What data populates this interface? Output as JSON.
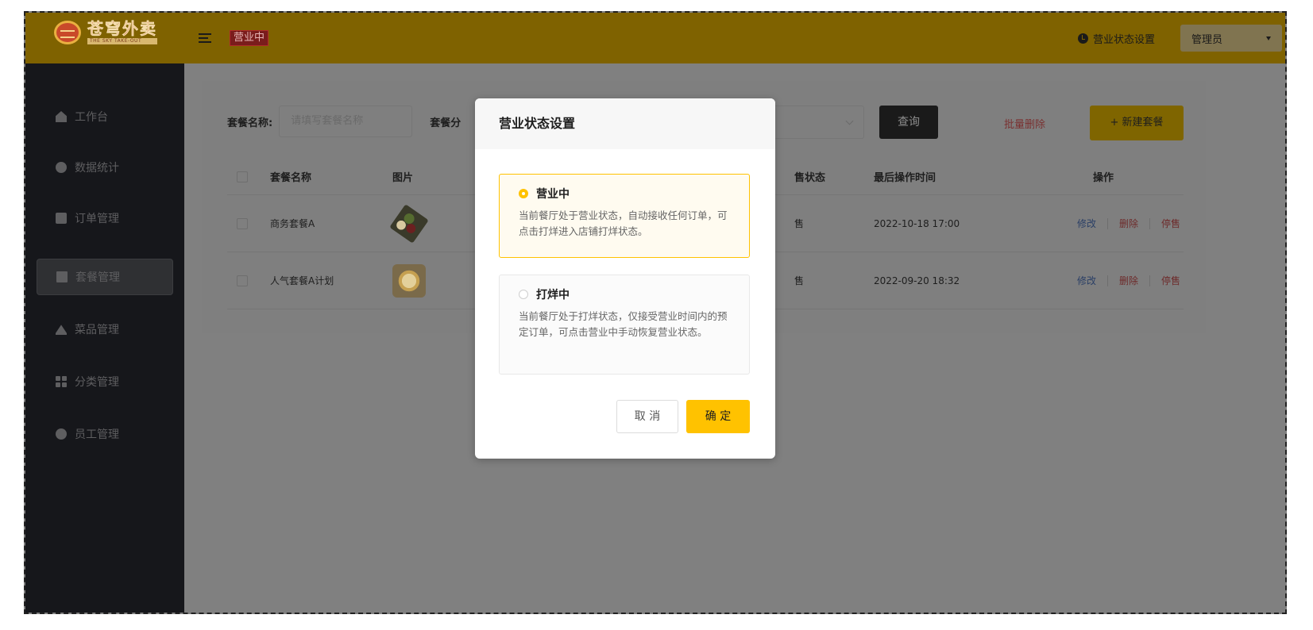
{
  "header": {
    "logo_cn": "苍穹外卖",
    "logo_en": "THE SKY TAKE-OUT",
    "status_tag": "营业中",
    "biz_setting_label": "营业状态设置",
    "admin_label": "管理员"
  },
  "sidebar": {
    "items": [
      {
        "label": "工作台",
        "icon": "home-icon"
      },
      {
        "label": "数据统计",
        "icon": "chart-icon"
      },
      {
        "label": "订单管理",
        "icon": "order-icon"
      },
      {
        "label": "套餐管理",
        "icon": "combo-icon",
        "active": true
      },
      {
        "label": "菜品管理",
        "icon": "dish-icon"
      },
      {
        "label": "分类管理",
        "icon": "category-icon"
      },
      {
        "label": "员工管理",
        "icon": "staff-icon"
      }
    ]
  },
  "main": {
    "search": {
      "name_label": "套餐名称:",
      "name_placeholder": "请填写套餐名称",
      "category_label": "套餐分"
    },
    "query_button": "查询",
    "batch_delete": "批量删除",
    "new_button": "+ 新建套餐",
    "table": {
      "headers": {
        "name": "套餐名称",
        "image": "图片",
        "status": "售状态",
        "time": "最后操作时间",
        "ops": "操作"
      },
      "rows": [
        {
          "name": "商务套餐A",
          "status": "售",
          "time": "2022-10-18 17:00",
          "edit": "修改",
          "delete": "删除",
          "stop": "停售"
        },
        {
          "name": "人气套餐A计划",
          "status": "售",
          "time": "2022-09-20 18:32",
          "edit": "修改",
          "delete": "删除",
          "stop": "停售"
        }
      ]
    }
  },
  "dialog": {
    "title": "营业状态设置",
    "options": [
      {
        "title": "营业中",
        "desc": "当前餐厅处于营业状态，自动接收任何订单，可点击打烊进入店铺打烊状态。",
        "selected": true
      },
      {
        "title": "打烊中",
        "desc": "当前餐厅处于打烊状态，仅接受营业时间内的预定订单，可点击营业中手动恢复营业状态。",
        "selected": false
      }
    ],
    "cancel": "取 消",
    "confirm": "确 定"
  },
  "colors": {
    "accent": "#ffc200",
    "header_bg": "#7f6200",
    "sidebar_bg": "#16171b"
  }
}
